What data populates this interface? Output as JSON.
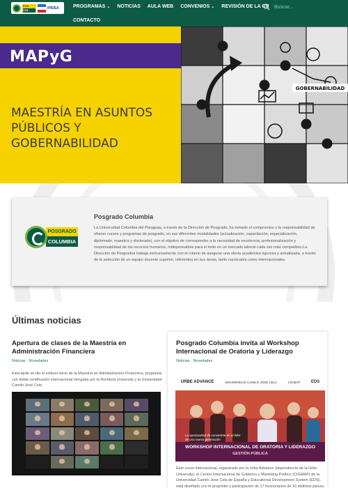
{
  "nav": {
    "logo_text": "IPIDEA",
    "items": [
      {
        "label": "PROGRAMAS",
        "dropdown": true
      },
      {
        "label": "NOTICIAS",
        "dropdown": false
      },
      {
        "label": "AULA WEB",
        "dropdown": false
      },
      {
        "label": "CONVENIOS",
        "dropdown": true
      },
      {
        "label": "REVISIÓN DE LA CN",
        "dropdown": false
      }
    ],
    "item_second_row": "CONTACTO",
    "search_placeholder": "Buscar...",
    "bg_color": "#0d5a45"
  },
  "hero": {
    "acronym": "MAPyG",
    "title": "MAESTRÍA EN ASUNTOS PÚBLICOS Y GOBERNABILIDAD",
    "image_label": "GOBERNABILIDAD",
    "yellow": "#f5d200",
    "purple": "#4a2a8c"
  },
  "about": {
    "logo_top": "POSGRADO",
    "logo_bottom": "COLUMBIA",
    "title": "Posgrado Columbia",
    "text": "La Universidad Columbia del Paraguay, a través de la Dirección de Posgrado, ha tomado el compromiso y la responsabilidad de ofrecer cursos y programas de posgrado, en sus diferentes modalidades (actualización, capacitación, especialización, diplomado, maestría y doctorado), con el objetivo de corresponder a la necesidad de excelencia, profesionalización y responsabilidad de los recursos humanos, indispensables para el éxito en un mercado laboral cada vez más competitivo.La Dirección de Posgrados trabaja exclusivamente con el criterio de asegurar una oferta académica rigurosa y actualizada, a través de la selección de un equipo docente superior, referentes en sus áreas, tanto nacionales como internacionales."
  },
  "news": {
    "heading": "Últimas noticias",
    "items": [
      {
        "title": "Apertura de clases de la Maestría en Administración Financiera",
        "categories": "Noticias · Novedades",
        "excerpt": "Esta tarde se dio el exitoso inicio de la Maestría en Administración Financiera, programa con doble certificación internacional otorgada por la Rockford University y la Universidad Camilo José Cela"
      },
      {
        "title": "Posgrado Columbia invita al Workshop Internacional de Oratoria y Liderazgo",
        "categories": "Noticias · Novedades",
        "excerpt": "Este curso internacional, organizado por la Urbe Advance (dependencia de la Urbe University), el Centro Internacional de Gobierno y Marketing Político (CIGMAP) de la Universidad Camilo José Cela de España y Educational Development System (EDS), está diseñado con el propósito y participación de 17 funcionarios de 10 distintos países",
        "logos": [
          "URBE ADVANCE",
          "UNIVERSIDAD CAMILO JOSÉ CELA",
          "CIGMAP",
          "EDS"
        ],
        "banner_title": "WORKSHOP INTERNACIONAL DE ORATORIA Y LIDERAZGO",
        "banner_subtitle": "GESTIÓN PÚBLICA",
        "tagline": "La oportunidad de convertirte en el líder de una nueva generación"
      }
    ]
  }
}
